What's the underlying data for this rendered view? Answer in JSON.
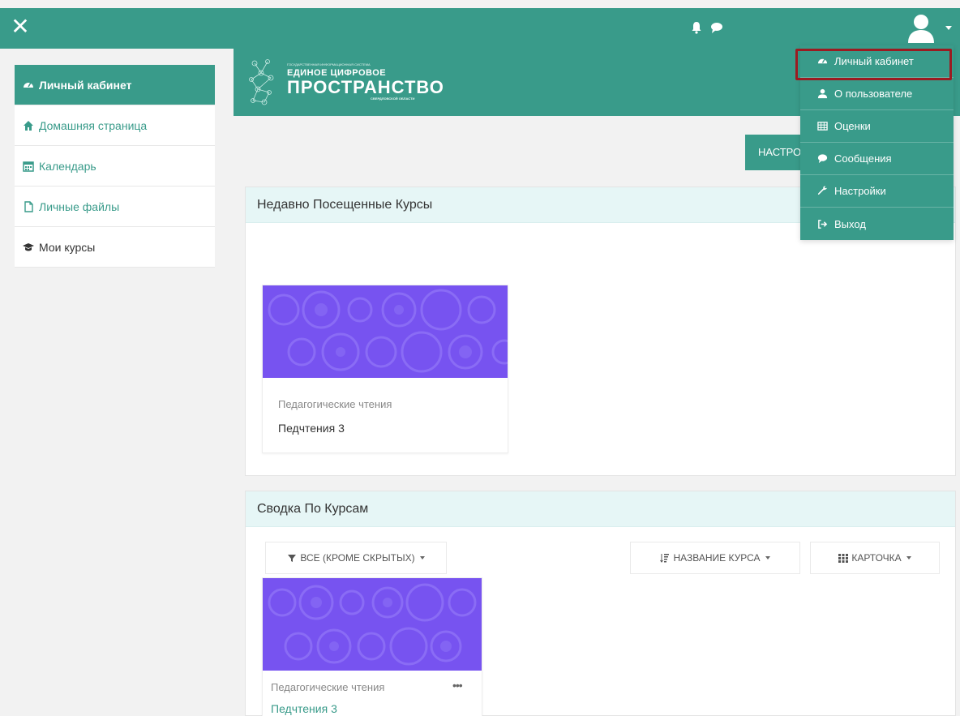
{
  "navbar": {
    "close_icon": "close-icon",
    "bell_icon": "bell-icon",
    "chat_icon": "chat-icon",
    "user_icon": "user-icon",
    "bg_color": "#399b8a"
  },
  "sidebar": {
    "items": [
      {
        "label": "Личный кабинет",
        "icon": "dashboard-icon",
        "active": true
      },
      {
        "label": "Домашняя страница",
        "icon": "home-icon"
      },
      {
        "label": "Календарь",
        "icon": "calendar-icon"
      },
      {
        "label": "Личные файлы",
        "icon": "file-icon"
      },
      {
        "label": "Мои курсы",
        "icon": "graduation-cap-icon"
      }
    ]
  },
  "banner": {
    "logo_line_tiny": "ГОСУДАРСТВЕННАЯ ИНФОРМАЦИОННАЯ СИСТЕМА",
    "logo_line1": "ЕДИНОЕ ЦИФРОВОЕ",
    "logo_line2": "ПРОСТРАНСТВО",
    "logo_line3": "СВЕРДЛОВСКОЙ ОБЛАСТИ"
  },
  "customize_button": "НАСТРОИТЬ ЭТУ СТРАНИЦУ",
  "recent": {
    "title": "Недавно Посещенные Курсы",
    "course": {
      "category": "Педагогические чтения",
      "name": "Педчтения 3"
    }
  },
  "overview": {
    "title": "Сводка По Курсам",
    "filter_label": "ВСЕ (КРОМЕ СКРЫТЫХ)",
    "sort_label": "НАЗВАНИЕ КУРСА",
    "view_label": "КАРТОЧКА",
    "course": {
      "category": "Педагогические чтения",
      "name": "Педчтения 3",
      "more": "•••"
    }
  },
  "user_menu": {
    "items": [
      {
        "label": "Личный кабинет",
        "icon": "dashboard-icon",
        "highlighted": true
      },
      {
        "label": "О пользователе",
        "icon": "user-icon"
      },
      {
        "label": "Оценки",
        "icon": "grades-table-icon"
      },
      {
        "label": "Сообщения",
        "icon": "chat-icon"
      },
      {
        "label": "Настройки",
        "icon": "wrench-icon"
      },
      {
        "label": "Выход",
        "icon": "logout-icon"
      }
    ]
  },
  "colors": {
    "accent": "#399b8a",
    "block_header": "#e6f6f6",
    "course_image": "#7753f0",
    "highlight_border": "#9b1b21"
  }
}
